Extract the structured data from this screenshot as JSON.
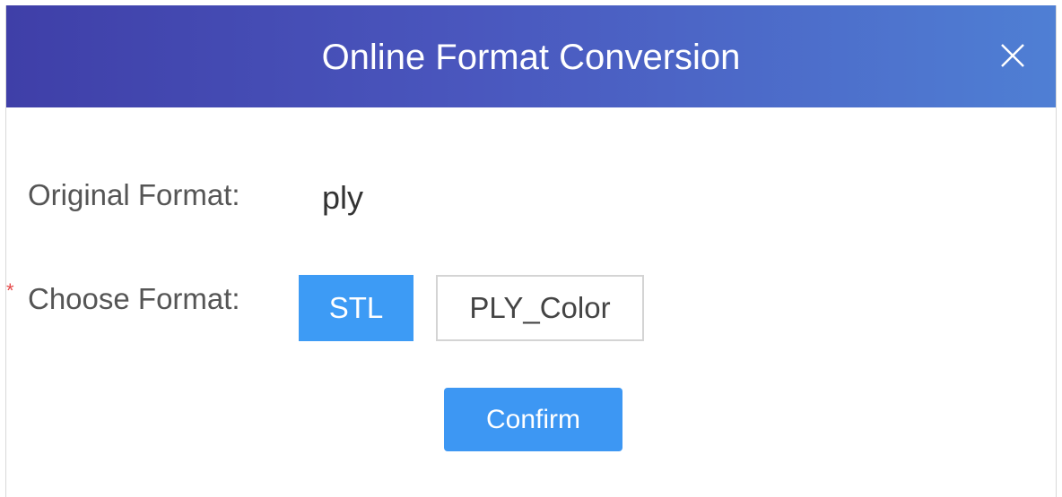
{
  "dialog": {
    "title": "Online Format Conversion",
    "close_icon": "close-icon"
  },
  "form": {
    "original_format_label": "Original Format:",
    "original_format_value": "ply",
    "required_marker": "*",
    "choose_format_label": "Choose Format:",
    "format_options": [
      "STL",
      "PLY_Color"
    ],
    "selected_format": "STL",
    "confirm_label": "Confirm"
  },
  "colors": {
    "header_gradient_start": "#3f3fa8",
    "header_gradient_end": "#4f7fd4",
    "accent": "#3d9bf5",
    "required": "#e54848"
  }
}
